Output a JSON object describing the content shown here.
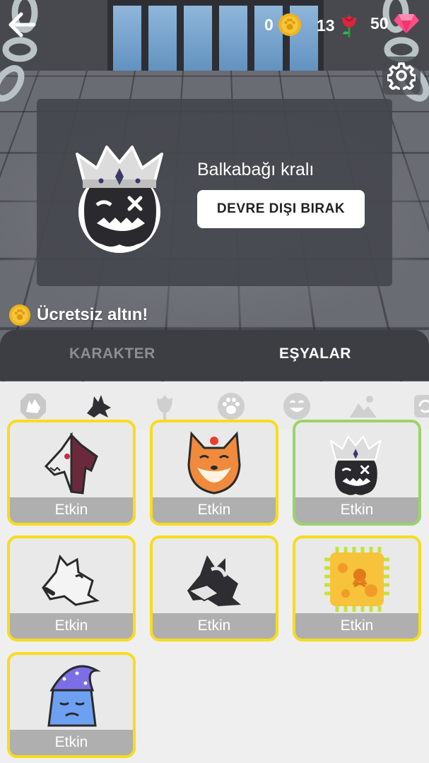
{
  "header": {
    "gold_count": "0",
    "rose_count": "13",
    "gem_count": "50"
  },
  "preview": {
    "item_name": "Balkabağı kralı",
    "disable_label": "DEVRE DIŞI BIRAK"
  },
  "free_gold_label": "Ücretsiz altın!",
  "tabs": [
    {
      "label": "KARAKTER",
      "selected": false
    },
    {
      "label": "EŞYALAR",
      "selected": true
    }
  ],
  "categories": [
    {
      "icon": "wolf-badge-icon",
      "selected": false
    },
    {
      "icon": "wolf-icon",
      "selected": true
    },
    {
      "icon": "rose-icon",
      "selected": false
    },
    {
      "icon": "paw-icon",
      "selected": false
    },
    {
      "icon": "smiley-icon",
      "selected": false
    },
    {
      "icon": "landscape-icon",
      "selected": false
    },
    {
      "icon": "refresh-icon",
      "selected": false
    }
  ],
  "items": [
    {
      "icon": "split-wolf-avatar-icon",
      "status": "Etkin",
      "equipped": false
    },
    {
      "icon": "fox-avatar-icon",
      "status": "Etkin",
      "equipped": false
    },
    {
      "icon": "pumpkin-king-avatar-icon",
      "status": "Etkin",
      "equipped": true
    },
    {
      "icon": "white-wolf-avatar-icon",
      "status": "Etkin",
      "equipped": false
    },
    {
      "icon": "horned-wolf-avatar-icon",
      "status": "Etkin",
      "equipped": false
    },
    {
      "icon": "skull-chip-avatar-icon",
      "status": "Etkin",
      "equipped": false
    },
    {
      "icon": "sleepy-wizard-avatar-icon",
      "status": "Etkin",
      "equipped": false
    }
  ],
  "colors": {
    "card_border": "#f7dc1f",
    "card_border_equipped": "#9bd36a",
    "tabbar": "#3c3e44",
    "gold": "#f2b21c",
    "rose": "#d9263a",
    "gem": "#ff4f86"
  }
}
